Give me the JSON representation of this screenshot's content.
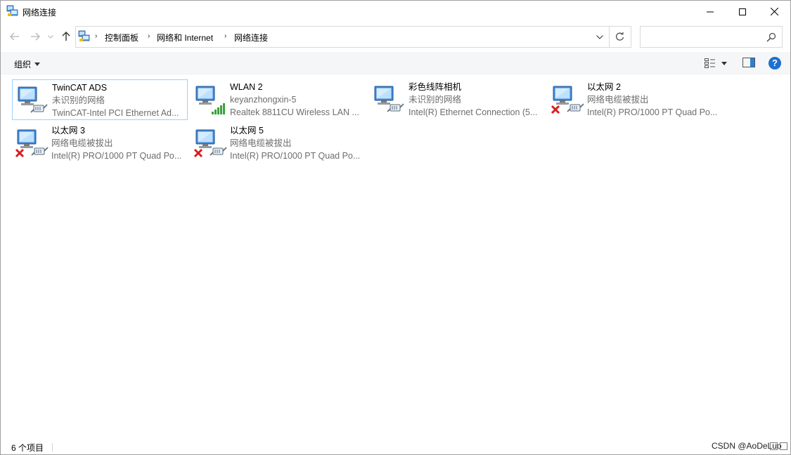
{
  "window": {
    "title": "网络连接",
    "controls": {
      "minimize": "minimize",
      "maximize": "maximize",
      "close": "close"
    }
  },
  "address": {
    "breadcrumbs": [
      "控制面板",
      "网络和 Internet",
      "网络连接"
    ],
    "search_placeholder": ""
  },
  "commandbar": {
    "organize_label": "组织",
    "help_label": "?"
  },
  "connections": [
    {
      "name": "TwinCAT ADS",
      "status": "未识别的网络",
      "adapter": "TwinCAT-Intel PCI Ethernet Ad...",
      "state": "unidentified",
      "selected": true
    },
    {
      "name": "WLAN 2",
      "status": "keyanzhongxin-5",
      "adapter": "Realtek 8811CU Wireless LAN ...",
      "state": "wireless",
      "selected": false
    },
    {
      "name": "彩色线阵相机",
      "status": "未识别的网络",
      "adapter": "Intel(R) Ethernet Connection (5...",
      "state": "unidentified",
      "selected": false
    },
    {
      "name": "以太网 2",
      "status": "网络电缆被拔出",
      "adapter": "Intel(R) PRO/1000 PT Quad Po...",
      "state": "disconnected",
      "selected": false
    },
    {
      "name": "以太网 3",
      "status": "网络电缆被拔出",
      "adapter": "Intel(R) PRO/1000 PT Quad Po...",
      "state": "disconnected",
      "selected": false
    },
    {
      "name": "以太网 5",
      "status": "网络电缆被拔出",
      "adapter": "Intel(R) PRO/1000 PT Quad Po...",
      "state": "disconnected",
      "selected": false
    }
  ],
  "statusbar": {
    "item_count": "6 个项目",
    "watermark": "CSDN @AoDeLuo"
  },
  "colors": {
    "accent": "#1f6fd0",
    "selection_border": "#99d1ff",
    "secondary_text": "#6d6d6d",
    "error_red": "#d81e1e",
    "signal_green": "#3aa33a"
  }
}
